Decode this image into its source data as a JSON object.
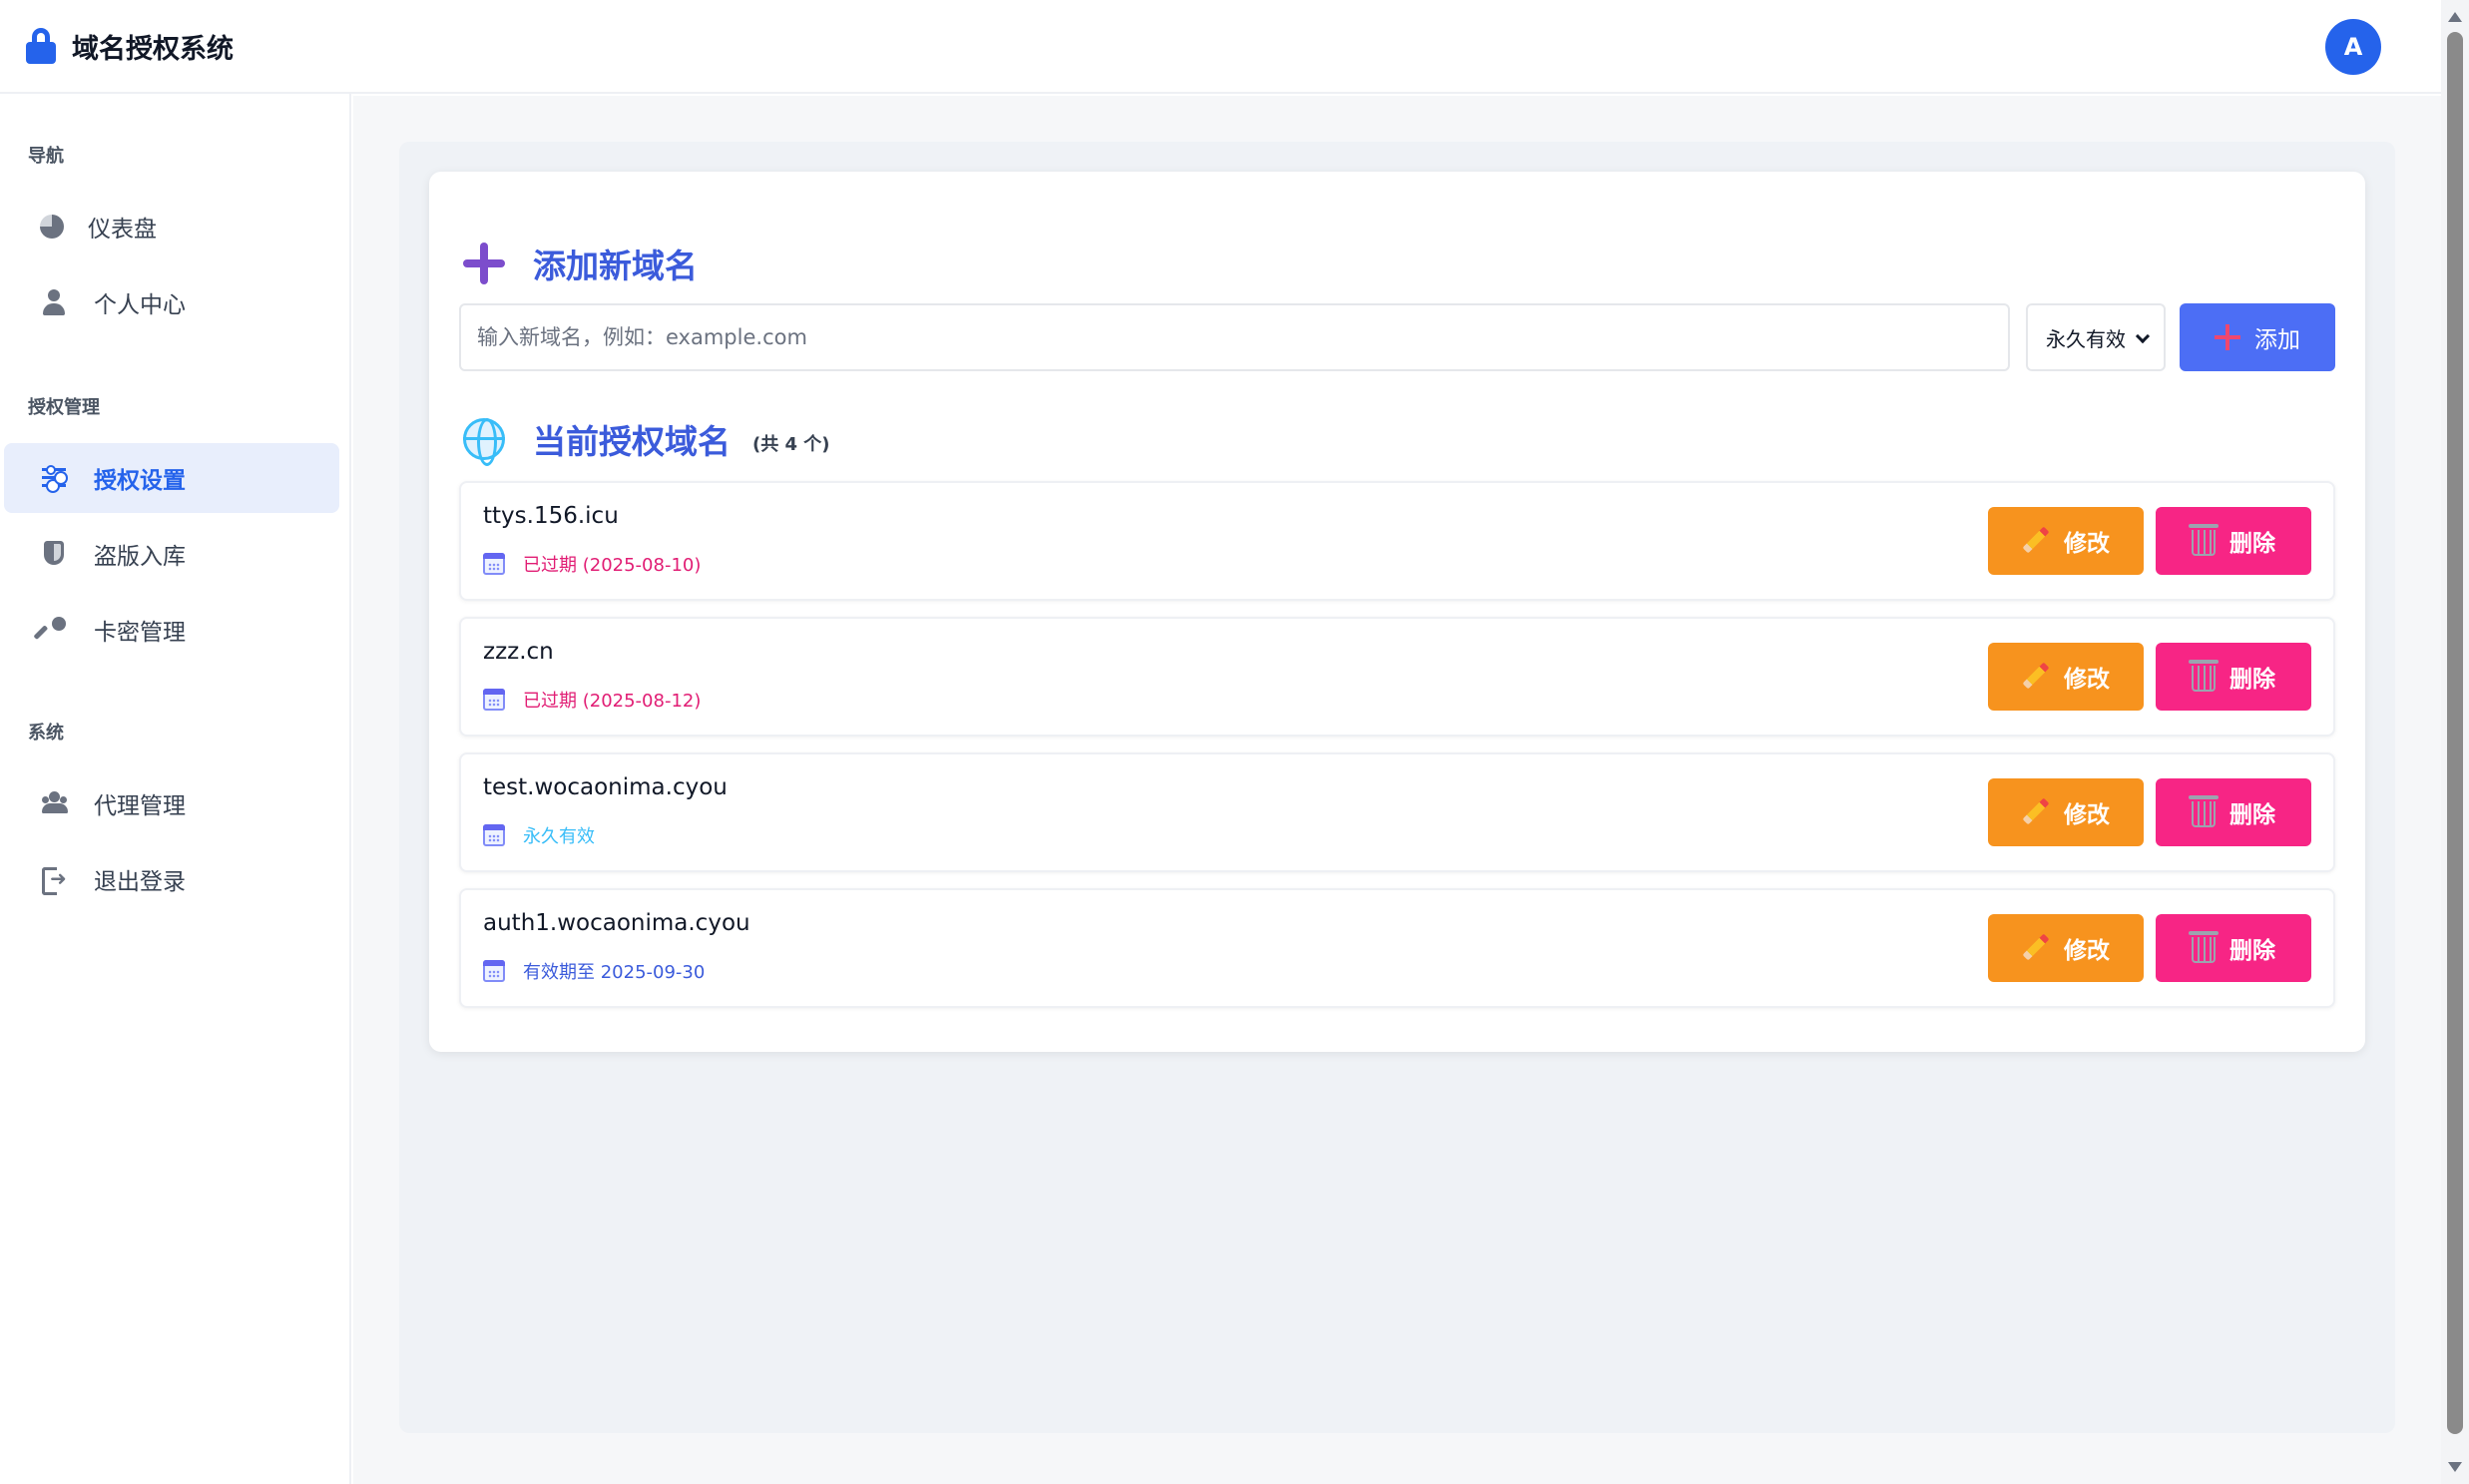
{
  "app": {
    "title": "域名授权系统",
    "avatar_letter": "A"
  },
  "sidebar": {
    "sections": [
      {
        "label": "导航"
      },
      {
        "label": "授权管理"
      },
      {
        "label": "系统"
      }
    ],
    "items": [
      {
        "label": "仪表盘",
        "icon": "pie-chart-icon"
      },
      {
        "label": "个人中心",
        "icon": "user-icon"
      },
      {
        "label": "授权设置",
        "icon": "sliders-icon",
        "active": true
      },
      {
        "label": "盗版入库",
        "icon": "shield-icon"
      },
      {
        "label": "卡密管理",
        "icon": "key-icon"
      },
      {
        "label": "代理管理",
        "icon": "users-icon"
      },
      {
        "label": "退出登录",
        "icon": "logout-icon"
      }
    ]
  },
  "add_section": {
    "title": "添加新域名",
    "input_placeholder": "输入新域名，例如：example.com",
    "input_value": "",
    "expiry_selected": "永久有效",
    "add_label": "添加"
  },
  "list_section": {
    "title": "当前授权域名",
    "count_text": "(共 4 个)"
  },
  "domains": [
    {
      "name": "ttys.156.icu",
      "status": "已过期 (2025-08-10)",
      "status_type": "expired"
    },
    {
      "name": "zzz.cn",
      "status": "已过期 (2025-08-12)",
      "status_type": "expired"
    },
    {
      "name": "test.wocaonima.cyou",
      "status": "永久有效",
      "status_type": "forever"
    },
    {
      "name": "auth1.wocaonima.cyou",
      "status": "有效期至 2025-09-30",
      "status_type": "valid"
    }
  ],
  "actions": {
    "edit_label": "修改",
    "delete_label": "删除"
  },
  "colors": {
    "primary": "#2563eb",
    "edit": "#f7931e",
    "delete": "#f72585",
    "expired": "#e11d74",
    "forever": "#38bdf8",
    "valid": "#3b5bdb"
  }
}
